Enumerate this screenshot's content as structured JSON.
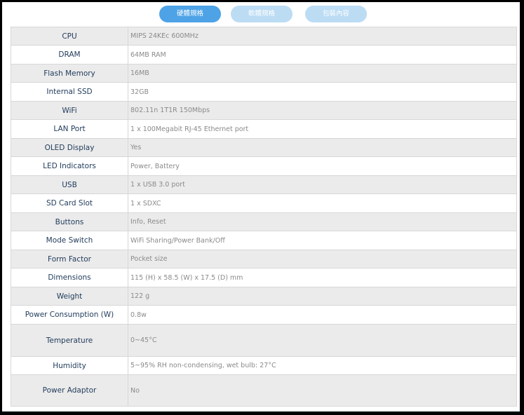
{
  "tabs": [
    {
      "label": "硬體規格"
    },
    {
      "label": "軟體規格"
    },
    {
      "label": "包裝內容"
    }
  ],
  "specs": [
    {
      "label": "CPU",
      "value": "MIPS 24KEc 600MHz"
    },
    {
      "label": "DRAM",
      "value": "64MB RAM"
    },
    {
      "label": "Flash Memory",
      "value": "16MB"
    },
    {
      "label": "Internal SSD",
      "value": "32GB"
    },
    {
      "label": "WiFi",
      "value": "802.11n 1T1R 150Mbps"
    },
    {
      "label": "LAN Port",
      "value": "1 x 100Megabit RJ-45 Ethernet port"
    },
    {
      "label": "OLED Display",
      "value": "Yes"
    },
    {
      "label": "LED Indicators",
      "value": "Power, Battery"
    },
    {
      "label": "USB",
      "value": "1 x USB 3.0 port"
    },
    {
      "label": "SD Card Slot",
      "value": "1 x SDXC"
    },
    {
      "label": "Buttons",
      "value": "Info, Reset"
    },
    {
      "label": "Mode Switch",
      "value": "WiFi Sharing/Power Bank/Off"
    },
    {
      "label": "Form Factor",
      "value": "Pocket size"
    },
    {
      "label": "Dimensions",
      "value": "115 (H) x 58.5 (W) x 17.5 (D) mm"
    },
    {
      "label": "Weight",
      "value": "122 g"
    },
    {
      "label": "Power Consumption (W)",
      "value": "0.8w"
    },
    {
      "label": "Temperature",
      "value": "0~45°C"
    },
    {
      "label": "Humidity",
      "value": "5~95% RH non-condensing, wet bulb: 27°C"
    },
    {
      "label": "Power Adaptor",
      "value": "No"
    }
  ]
}
